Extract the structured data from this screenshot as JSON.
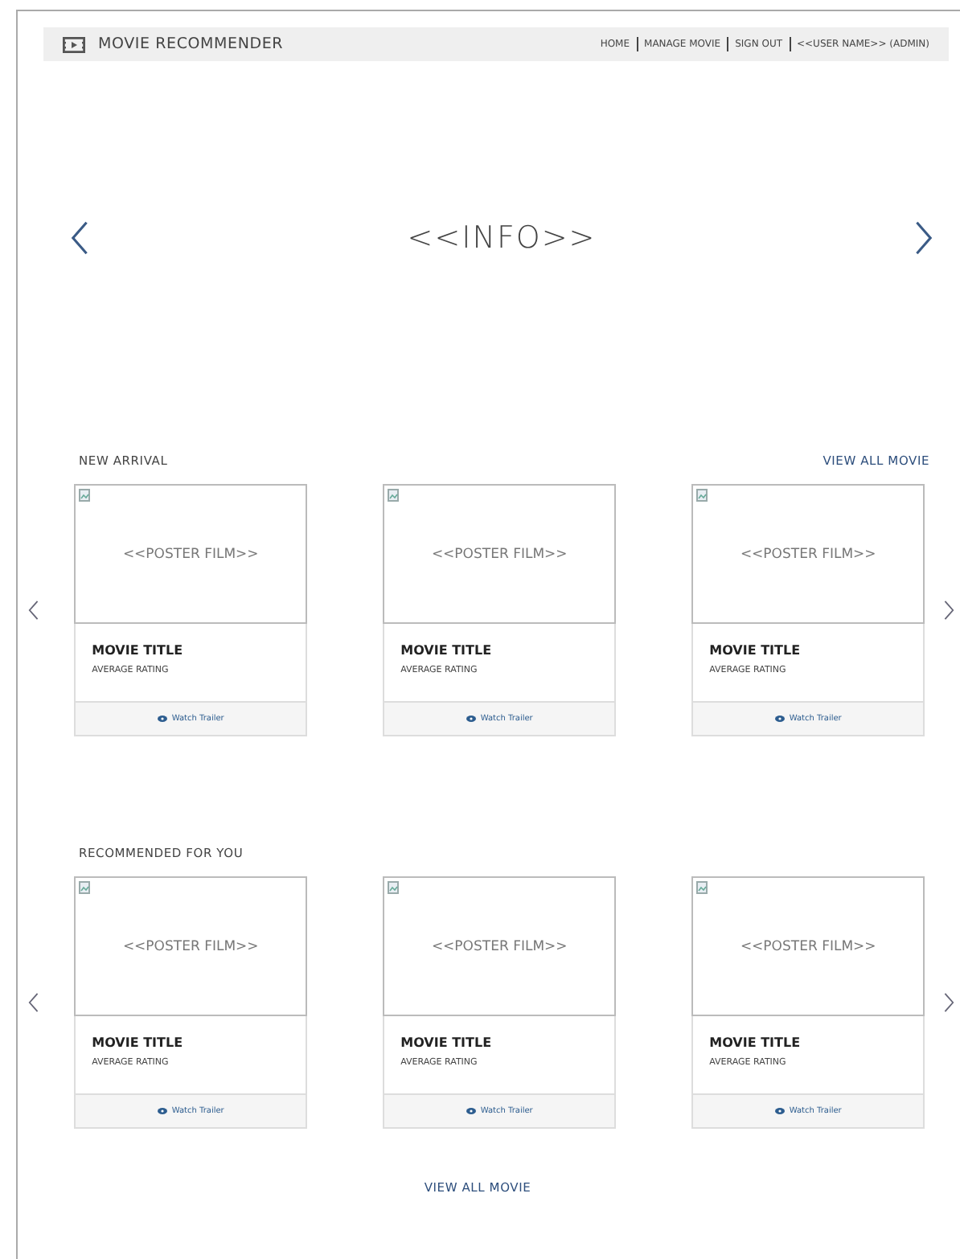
{
  "header": {
    "title": "MOVIE RECOMMENDER",
    "nav": [
      "HOME",
      "MANAGE MOVIE",
      "SIGN OUT",
      "<<USER NAME>> (ADMIN)"
    ]
  },
  "hero": {
    "text": "<<INFO>>"
  },
  "sections": [
    {
      "title": "NEW ARRIVAL",
      "link": "VIEW ALL MOVIE",
      "cards": [
        {
          "poster": "<<POSTER FILM>>",
          "title": "MOVIE TITLE",
          "rating": "AVERAGE RATING",
          "action": "Watch Trailer"
        },
        {
          "poster": "<<POSTER FILM>>",
          "title": "MOVIE TITLE",
          "rating": "AVERAGE RATING",
          "action": "Watch Trailer"
        },
        {
          "poster": "<<POSTER FILM>>",
          "title": "MOVIE TITLE",
          "rating": "AVERAGE RATING",
          "action": "Watch Trailer"
        }
      ]
    },
    {
      "title": "RECOMMENDED FOR YOU",
      "cards": [
        {
          "poster": "<<POSTER FILM>>",
          "title": "MOVIE TITLE",
          "rating": "AVERAGE RATING",
          "action": "Watch Trailer"
        },
        {
          "poster": "<<POSTER FILM>>",
          "title": "MOVIE TITLE",
          "rating": "AVERAGE RATING",
          "action": "Watch Trailer"
        },
        {
          "poster": "<<POSTER FILM>>",
          "title": "MOVIE TITLE",
          "rating": "AVERAGE RATING",
          "action": "Watch Trailer"
        }
      ]
    }
  ],
  "footer_link": "VIEW ALL MOVIE"
}
